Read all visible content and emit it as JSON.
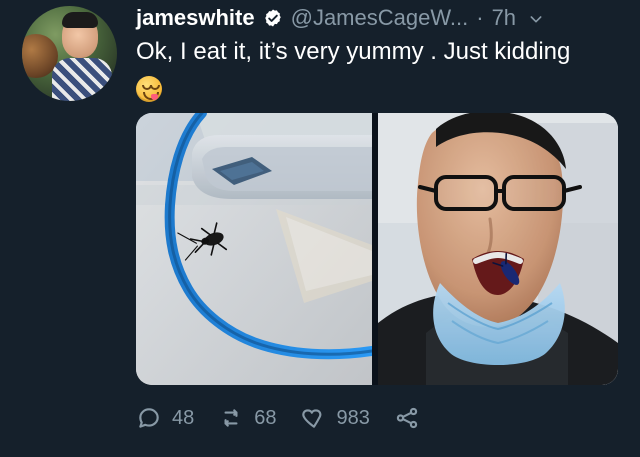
{
  "tweet": {
    "author": {
      "display_name": "jameswhite",
      "handle": "@JamesCageW...",
      "time_separator": "·",
      "time": "7h"
    },
    "text": "Ok, I eat it, it’s very yummy . Just kidding",
    "icons": {
      "verified": "verified-badge-icon",
      "more": "chevron-down-icon",
      "emoji": "face-savoring-food-emoji"
    }
  },
  "actions": {
    "reply_count": "48",
    "retweet_count": "68",
    "like_count": "983"
  },
  "colors": {
    "background": "#15202b",
    "text_primary": "#ffffff",
    "text_secondary": "#8899a6",
    "verified_bg": "#ffffff",
    "verified_check": "#15202b"
  }
}
